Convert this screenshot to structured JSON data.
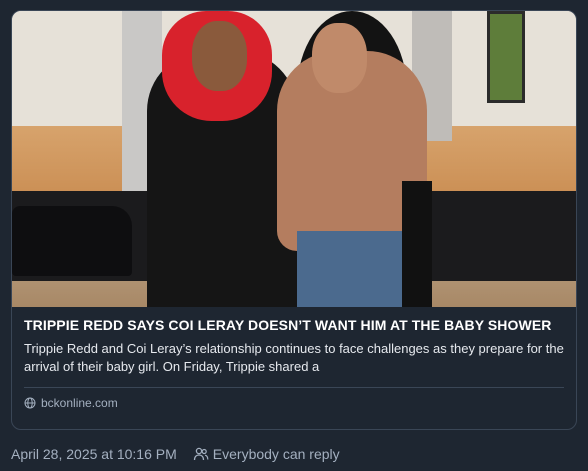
{
  "card": {
    "title": "TRIPPIE REDD SAYS COI LERAY DOESN’T WANT HIM AT THE BABY SHOWER",
    "description": "Trippie Redd and Coi Leray’s relationship continues to face challenges as they prepare for the arrival of their baby girl. On Friday, Trippie shared a",
    "domain": "bckonline.com",
    "domain_icon": "globe-icon"
  },
  "meta": {
    "timestamp": "April 28, 2025 at 10:16 PM",
    "reply_setting": "Everybody can reply",
    "reply_icon": "people-icon"
  },
  "colors": {
    "background": "#1e2631",
    "border": "#3a4656",
    "muted_text": "#a4b0c0"
  }
}
